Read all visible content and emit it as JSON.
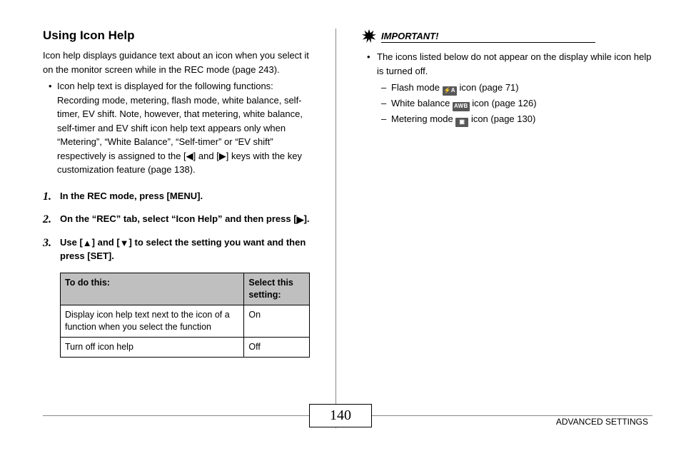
{
  "title": "Using Icon Help",
  "intro": "Icon help displays guidance text about an icon when you select it on the monitor screen while in the REC mode (page 243).",
  "bullet": "Icon help text is displayed for the following functions: Recording mode, metering, flash mode, white balance, self-timer, EV shift. Note, however, that metering, white balance, self-timer and EV shift icon help text appears only when “Metering”, “White Balance”, “Self-timer” or “EV shift” respectively is assigned to the [◀] and [▶] keys with the key customization feature (page 138).",
  "steps": {
    "s1": "In the REC mode, press [MENU].",
    "s2_a": "On the “REC” tab, select “Icon Help” and then press [",
    "s2_b": "].",
    "s3_a": "Use [",
    "s3_b": "] and [",
    "s3_c": "] to select the setting you want and then press [SET]."
  },
  "table": {
    "h1": "To do this:",
    "h2": "Select this setting:",
    "r1c1": "Display icon help text next to the icon of a function when you select the function",
    "r1c2": "On",
    "r2c1": "Turn off icon help",
    "r2c2": "Off"
  },
  "important_label": "IMPORTANT!",
  "right_bullet": "The icons listed below do not appear on the display while icon help is turned off.",
  "dash": {
    "d1_a": "Flash mode ",
    "d1_b": " icon (page 71)",
    "d2_a": "White balance ",
    "d2_b": " icon (page 126)",
    "d3_a": "Metering mode ",
    "d3_b": " icon (page 130)"
  },
  "icons": {
    "flash": "⚡A",
    "awb": "AWB",
    "metering": "▣"
  },
  "page_number": "140",
  "footer_label": "ADVANCED SETTINGS"
}
